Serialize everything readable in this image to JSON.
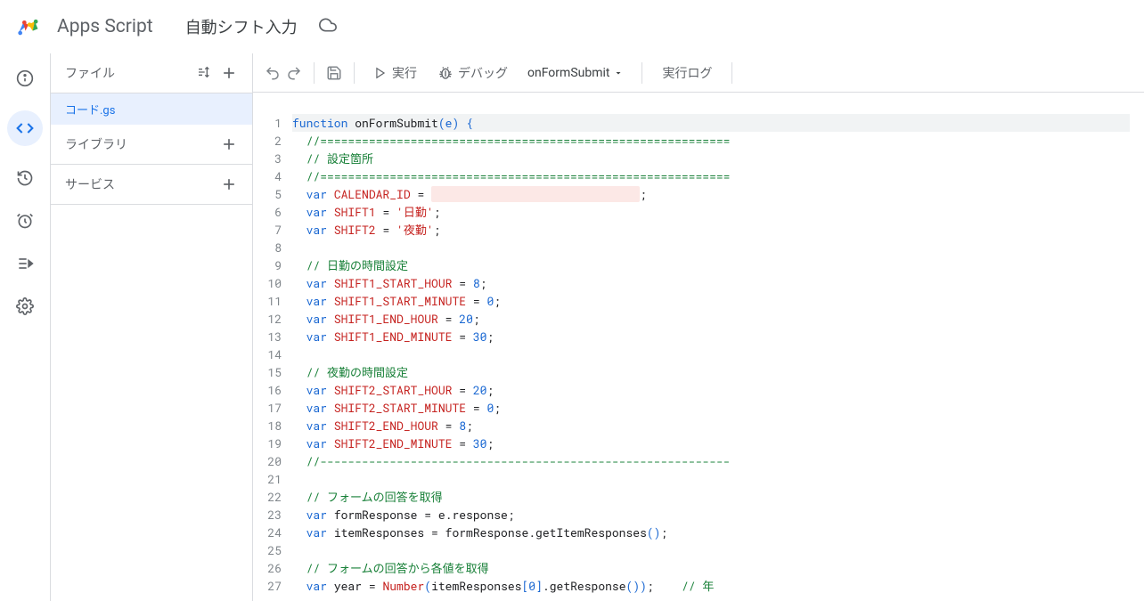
{
  "header": {
    "app_name": "Apps Script",
    "project_name": "自動シフト入力"
  },
  "sidebar": {
    "files_label": "ファイル",
    "file_name": "コード.gs",
    "libraries_label": "ライブラリ",
    "services_label": "サービス"
  },
  "toolbar": {
    "run_label": "実行",
    "debug_label": "デバッグ",
    "function_name": "onFormSubmit",
    "log_label": "実行ログ"
  },
  "code": {
    "lines": [
      {
        "n": 1,
        "hl": true,
        "tokens": [
          {
            "t": "function",
            "c": "kw"
          },
          {
            "t": " "
          },
          {
            "t": "onFormSubmit",
            "c": "fn"
          },
          {
            "t": "(",
            "c": "paren"
          },
          {
            "t": "e",
            "c": "paren"
          },
          {
            "t": ")",
            "c": "paren"
          },
          {
            "t": " "
          },
          {
            "t": "{",
            "c": "paren"
          }
        ]
      },
      {
        "n": 2,
        "tokens": [
          {
            "t": "  "
          },
          {
            "t": "//===========================================================",
            "c": "comment"
          }
        ]
      },
      {
        "n": 3,
        "tokens": [
          {
            "t": "  "
          },
          {
            "t": "// 設定箇所",
            "c": "comment"
          }
        ]
      },
      {
        "n": 4,
        "tokens": [
          {
            "t": "  "
          },
          {
            "t": "//===========================================================",
            "c": "comment"
          }
        ]
      },
      {
        "n": 5,
        "tokens": [
          {
            "t": "  "
          },
          {
            "t": "var",
            "c": "kw"
          },
          {
            "t": " "
          },
          {
            "t": "CALENDAR_ID",
            "c": "name"
          },
          {
            "t": " = "
          },
          {
            "t": "                              ",
            "c": "redacted"
          },
          {
            "t": ";"
          }
        ]
      },
      {
        "n": 6,
        "tokens": [
          {
            "t": "  "
          },
          {
            "t": "var",
            "c": "kw"
          },
          {
            "t": " "
          },
          {
            "t": "SHIFT1",
            "c": "name"
          },
          {
            "t": " = "
          },
          {
            "t": "'日勤'",
            "c": "str"
          },
          {
            "t": ";"
          }
        ]
      },
      {
        "n": 7,
        "tokens": [
          {
            "t": "  "
          },
          {
            "t": "var",
            "c": "kw"
          },
          {
            "t": " "
          },
          {
            "t": "SHIFT2",
            "c": "name"
          },
          {
            "t": " = "
          },
          {
            "t": "'夜勤'",
            "c": "str"
          },
          {
            "t": ";"
          }
        ]
      },
      {
        "n": 8,
        "tokens": []
      },
      {
        "n": 9,
        "tokens": [
          {
            "t": "  "
          },
          {
            "t": "// 日勤の時間設定",
            "c": "comment"
          }
        ]
      },
      {
        "n": 10,
        "tokens": [
          {
            "t": "  "
          },
          {
            "t": "var",
            "c": "kw"
          },
          {
            "t": " "
          },
          {
            "t": "SHIFT1_START_HOUR",
            "c": "name"
          },
          {
            "t": " = "
          },
          {
            "t": "8",
            "c": "num"
          },
          {
            "t": ";"
          }
        ]
      },
      {
        "n": 11,
        "tokens": [
          {
            "t": "  "
          },
          {
            "t": "var",
            "c": "kw"
          },
          {
            "t": " "
          },
          {
            "t": "SHIFT1_START_MINUTE",
            "c": "name"
          },
          {
            "t": " = "
          },
          {
            "t": "0",
            "c": "num"
          },
          {
            "t": ";"
          }
        ]
      },
      {
        "n": 12,
        "tokens": [
          {
            "t": "  "
          },
          {
            "t": "var",
            "c": "kw"
          },
          {
            "t": " "
          },
          {
            "t": "SHIFT1_END_HOUR",
            "c": "name"
          },
          {
            "t": " = "
          },
          {
            "t": "20",
            "c": "num"
          },
          {
            "t": ";"
          }
        ]
      },
      {
        "n": 13,
        "tokens": [
          {
            "t": "  "
          },
          {
            "t": "var",
            "c": "kw"
          },
          {
            "t": " "
          },
          {
            "t": "SHIFT1_END_MINUTE",
            "c": "name"
          },
          {
            "t": " = "
          },
          {
            "t": "30",
            "c": "num"
          },
          {
            "t": ";"
          }
        ]
      },
      {
        "n": 14,
        "tokens": []
      },
      {
        "n": 15,
        "tokens": [
          {
            "t": "  "
          },
          {
            "t": "// 夜勤の時間設定",
            "c": "comment"
          }
        ]
      },
      {
        "n": 16,
        "tokens": [
          {
            "t": "  "
          },
          {
            "t": "var",
            "c": "kw"
          },
          {
            "t": " "
          },
          {
            "t": "SHIFT2_START_HOUR",
            "c": "name"
          },
          {
            "t": " = "
          },
          {
            "t": "20",
            "c": "num"
          },
          {
            "t": ";"
          }
        ]
      },
      {
        "n": 17,
        "tokens": [
          {
            "t": "  "
          },
          {
            "t": "var",
            "c": "kw"
          },
          {
            "t": " "
          },
          {
            "t": "SHIFT2_START_MINUTE",
            "c": "name"
          },
          {
            "t": " = "
          },
          {
            "t": "0",
            "c": "num"
          },
          {
            "t": ";"
          }
        ]
      },
      {
        "n": 18,
        "tokens": [
          {
            "t": "  "
          },
          {
            "t": "var",
            "c": "kw"
          },
          {
            "t": " "
          },
          {
            "t": "SHIFT2_END_HOUR",
            "c": "name"
          },
          {
            "t": " = "
          },
          {
            "t": "8",
            "c": "num"
          },
          {
            "t": ";"
          }
        ]
      },
      {
        "n": 19,
        "tokens": [
          {
            "t": "  "
          },
          {
            "t": "var",
            "c": "kw"
          },
          {
            "t": " "
          },
          {
            "t": "SHIFT2_END_MINUTE",
            "c": "name"
          },
          {
            "t": " = "
          },
          {
            "t": "30",
            "c": "num"
          },
          {
            "t": ";"
          }
        ]
      },
      {
        "n": 20,
        "tokens": [
          {
            "t": "  "
          },
          {
            "t": "//-----------------------------------------------------------",
            "c": "comment"
          }
        ]
      },
      {
        "n": 21,
        "tokens": []
      },
      {
        "n": 22,
        "tokens": [
          {
            "t": "  "
          },
          {
            "t": "// フォームの回答を取得",
            "c": "comment"
          }
        ]
      },
      {
        "n": 23,
        "tokens": [
          {
            "t": "  "
          },
          {
            "t": "var",
            "c": "kw"
          },
          {
            "t": " formResponse = e.response;"
          }
        ]
      },
      {
        "n": 24,
        "tokens": [
          {
            "t": "  "
          },
          {
            "t": "var",
            "c": "kw"
          },
          {
            "t": " itemResponses = formResponse.getItemResponses"
          },
          {
            "t": "()",
            "c": "paren"
          },
          {
            "t": ";"
          }
        ]
      },
      {
        "n": 25,
        "tokens": []
      },
      {
        "n": 26,
        "tokens": [
          {
            "t": "  "
          },
          {
            "t": "// フォームの回答から各値を取得",
            "c": "comment"
          }
        ]
      },
      {
        "n": 27,
        "tokens": [
          {
            "t": "  "
          },
          {
            "t": "var",
            "c": "kw"
          },
          {
            "t": " year = "
          },
          {
            "t": "Number",
            "c": "name"
          },
          {
            "t": "(",
            "c": "paren"
          },
          {
            "t": "itemResponses"
          },
          {
            "t": "[",
            "c": "paren"
          },
          {
            "t": "0",
            "c": "num"
          },
          {
            "t": "]",
            "c": "paren"
          },
          {
            "t": ".getResponse"
          },
          {
            "t": "())",
            "c": "paren"
          },
          {
            "t": ";    "
          },
          {
            "t": "// 年",
            "c": "comment"
          }
        ]
      }
    ]
  }
}
